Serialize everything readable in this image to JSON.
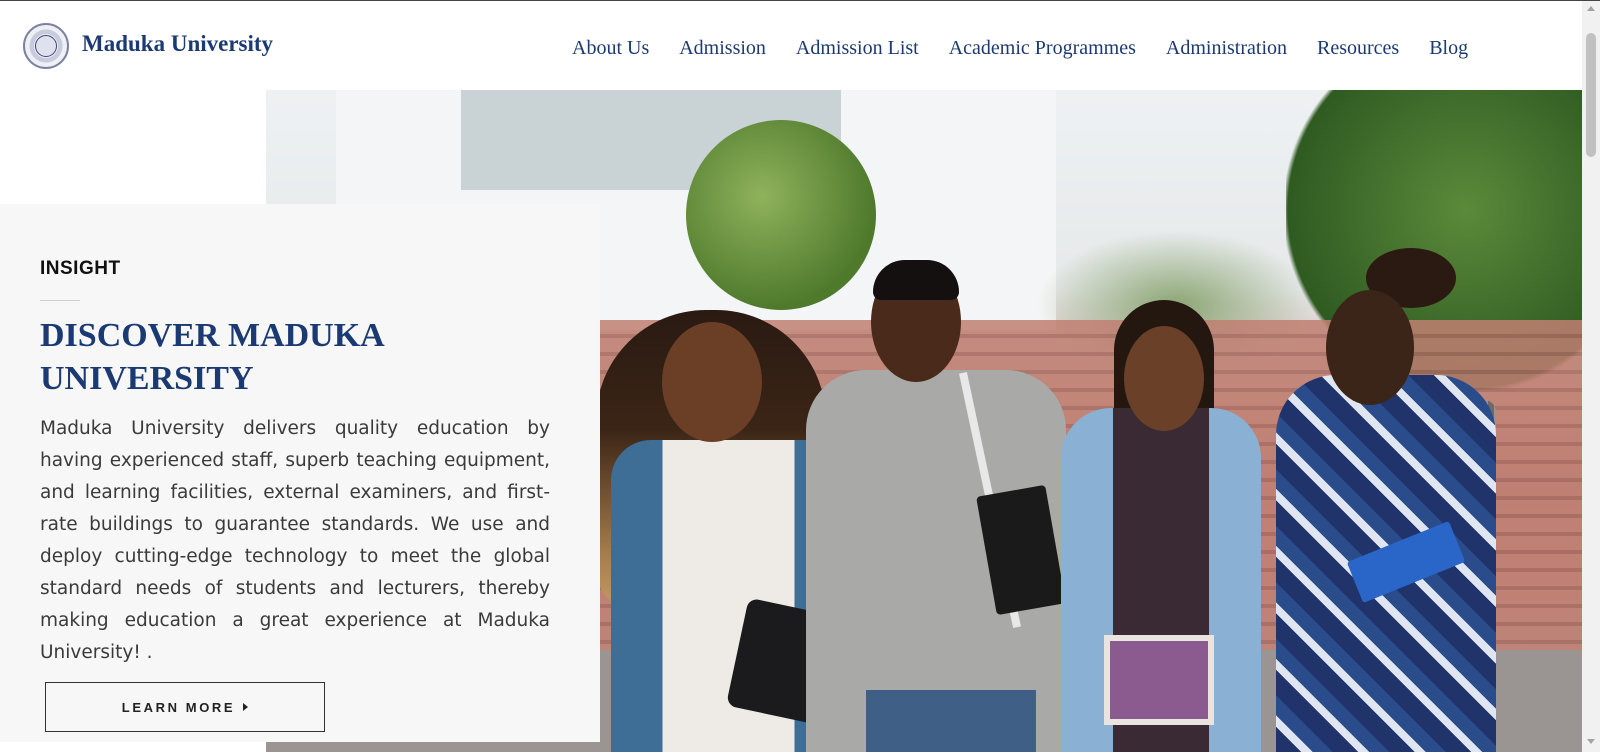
{
  "header": {
    "brand": "Maduka University",
    "nav": [
      {
        "label": "About Us"
      },
      {
        "label": "Admission"
      },
      {
        "label": "Admission List"
      },
      {
        "label": "Academic Programmes"
      },
      {
        "label": "Administration"
      },
      {
        "label": "Resources"
      },
      {
        "label": "Blog"
      }
    ]
  },
  "hero": {
    "card": {
      "eyebrow": "INSIGHT",
      "title": "DISCOVER MADUKA UNIVERSITY",
      "text": "Maduka University delivers quality education by having experienced staff, superb teaching equipment, and learning facilities, external examiners, and first-rate buildings to guarantee standards. We use and deploy cutting-edge technology to meet the global standard needs of students and lecturers, thereby making education a great experience at Maduka University! .",
      "button_label": "LEARN MORE"
    }
  },
  "colors": {
    "brand_navy": "#1b3a73",
    "card_bg": "#f7f7f7",
    "text": "#3a3a3a"
  },
  "icons": {
    "logo": "university-seal-icon",
    "button": "caret-right-icon"
  }
}
